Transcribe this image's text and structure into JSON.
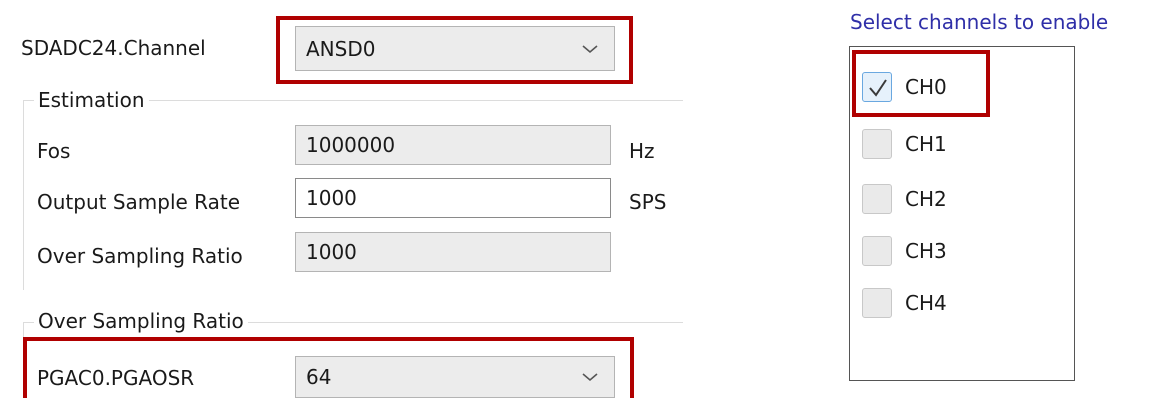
{
  "channel": {
    "label": "SDADC24.Channel",
    "value": "ANSD0"
  },
  "estimation": {
    "title": "Estimation",
    "fos": {
      "label": "Fos",
      "value": "1000000",
      "unit": "Hz"
    },
    "output_rate": {
      "label": "Output Sample Rate",
      "value": "1000",
      "unit": "SPS"
    },
    "osr": {
      "label": "Over Sampling Ratio",
      "value": "1000"
    }
  },
  "oversampling": {
    "title": "Over Sampling Ratio",
    "pgaosr": {
      "label": "PGAC0.PGAOSR",
      "value": "64"
    }
  },
  "channels": {
    "title": "Select channels to enable",
    "title_color": "#2f2fa8",
    "items": [
      {
        "label": "CH0",
        "checked": true
      },
      {
        "label": "CH1",
        "checked": false
      },
      {
        "label": "CH2",
        "checked": false
      },
      {
        "label": "CH3",
        "checked": false
      },
      {
        "label": "CH4",
        "checked": false
      }
    ]
  },
  "highlight_color": "#b00000"
}
